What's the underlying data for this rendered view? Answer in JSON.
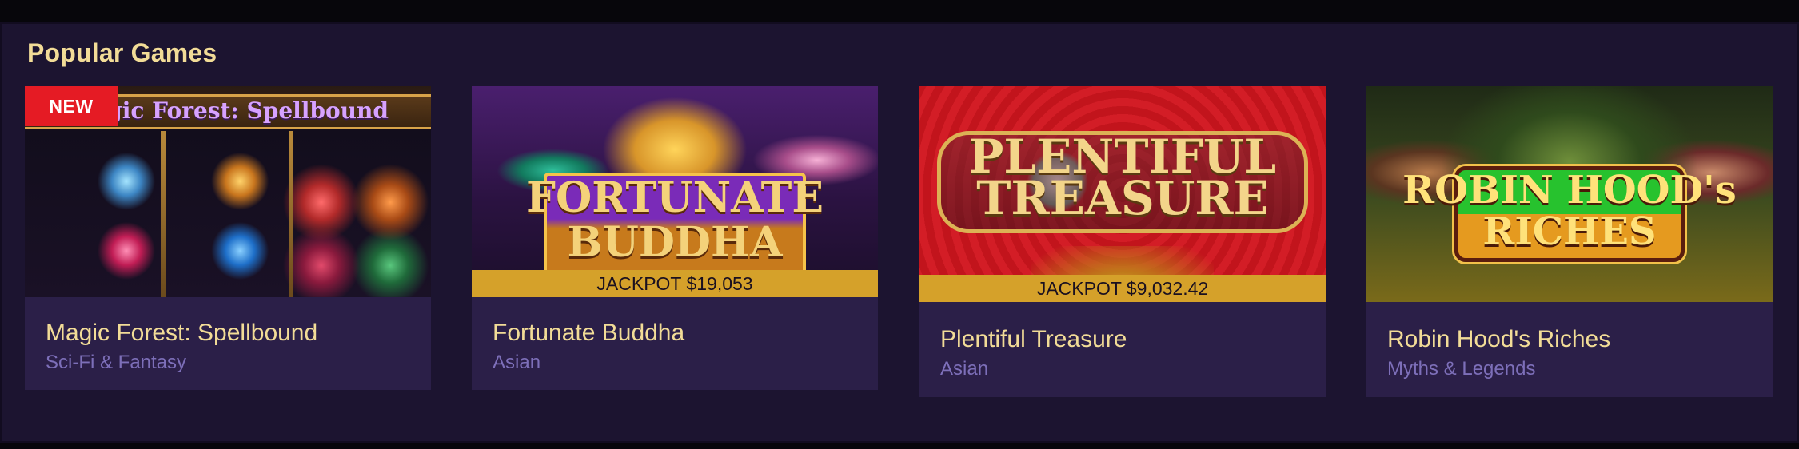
{
  "section": {
    "title": "Popular Games"
  },
  "colors": {
    "page_background": "#07060b",
    "section_background": "#1c1430",
    "card_background": "#2b1f48",
    "title_gold": "#f2dc97",
    "category_purple": "#7d6fb9",
    "badge_red": "#e51b24",
    "jackpot_gold": "#d5a12a"
  },
  "games": [
    {
      "name": "Magic Forest: Spellbound",
      "category": "Sci-Fi & Fantasy",
      "badge": "NEW",
      "artwork_text": "Magic Forest: Spellbound"
    },
    {
      "name": "Fortunate Buddha",
      "category": "Asian",
      "jackpot": "JACKPOT $19,053",
      "artwork_text": "FORTUNATE BUDDHA"
    },
    {
      "name": "Plentiful Treasure",
      "category": "Asian",
      "jackpot": "JACKPOT $9,032.42",
      "artwork_text": "PLENTIFUL TREASURE"
    },
    {
      "name": "Robin Hood's Riches",
      "category": "Myths & Legends",
      "artwork_text": "ROBIN HOOD's RICHES"
    }
  ]
}
